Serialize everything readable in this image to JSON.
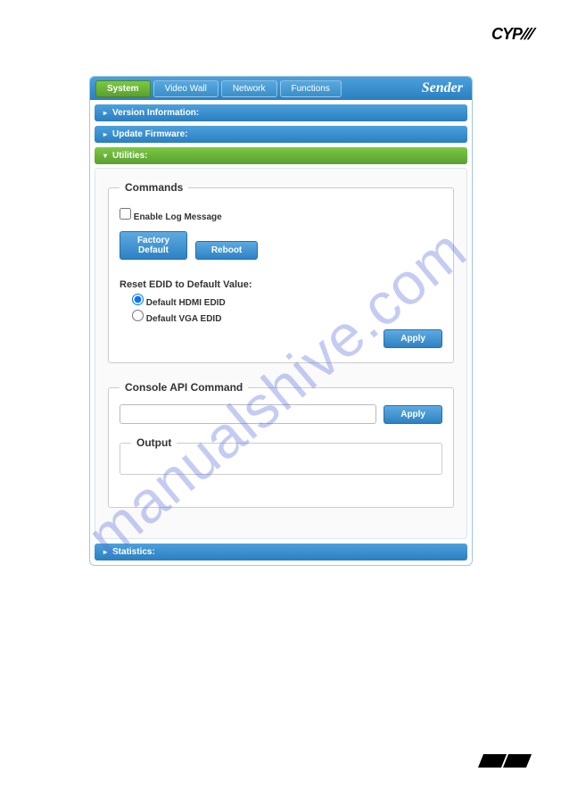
{
  "brand": "CYP",
  "app_title": "Sender",
  "tabs": [
    {
      "label": "System",
      "active": true
    },
    {
      "label": "Video Wall",
      "active": false
    },
    {
      "label": "Network",
      "active": false
    },
    {
      "label": "Functions",
      "active": false
    }
  ],
  "sections": {
    "version": "Version Information:",
    "update": "Update Firmware:",
    "utilities": "Utilities:",
    "statistics": "Statistics:"
  },
  "commands": {
    "legend": "Commands",
    "enable_log": "Enable Log Message",
    "factory_default": "Factory Default",
    "reboot": "Reboot",
    "reset_label": "Reset EDID to Default Value:",
    "radio_hdmi": "Default HDMI EDID",
    "radio_vga": "Default VGA EDID",
    "apply": "Apply"
  },
  "console": {
    "legend": "Console API Command",
    "apply": "Apply",
    "output_legend": "Output"
  },
  "watermark": "manualshive.com"
}
